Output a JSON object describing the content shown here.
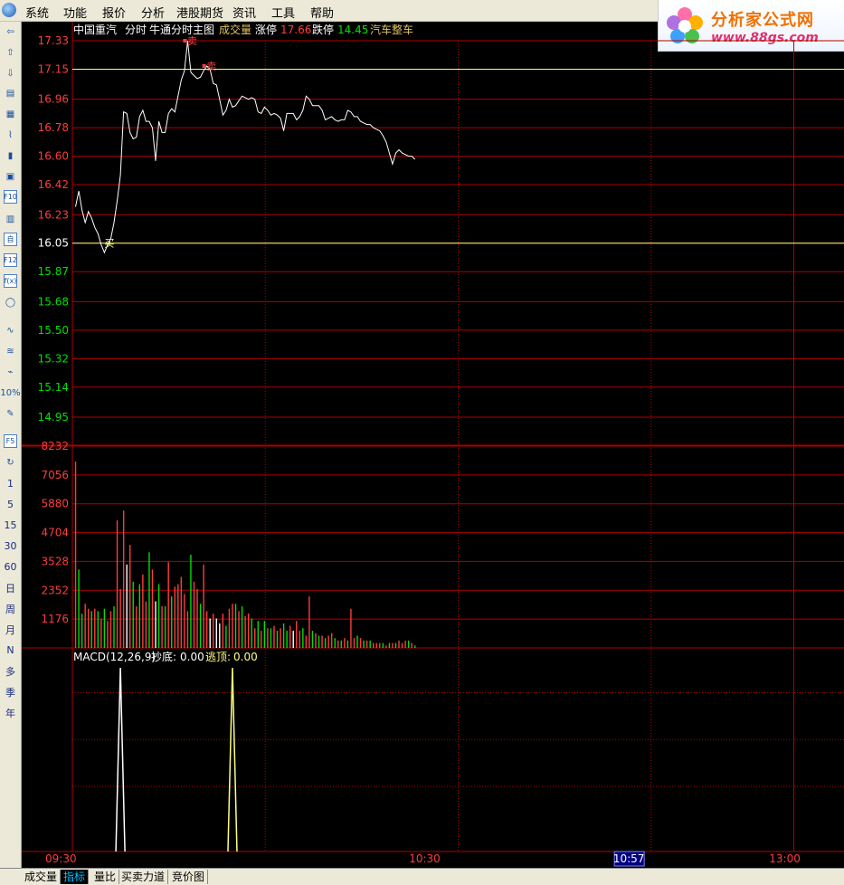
{
  "menu": [
    "系统",
    "功能",
    "报价",
    "分析",
    "港股期货",
    "资讯",
    "工具",
    "帮助"
  ],
  "brand": {
    "name": "分析家公式网",
    "url": "www.88gs.com"
  },
  "toolbar": {
    "icons": [
      "back-arrow-icon",
      "up-arrow-icon",
      "down-arrow-icon",
      "quote-list-icon",
      "grid-icon",
      "line-chart-icon",
      "candlestick-icon",
      "window-icon",
      "f10-icon",
      "file-icon",
      "self-select-icon",
      "f12-icon",
      "formula-icon",
      "circle-icon",
      "wave-icon",
      "area-wave-icon",
      "pulse-icon",
      "percent-icon",
      "pencil-icon",
      "f5-icon",
      "refresh-icon"
    ],
    "labels": {
      "f10": "F10",
      "self": "自",
      "f12": "F12",
      "fx": "f(x)",
      "pct": "10%",
      "f5": "F5"
    },
    "periods": [
      "1",
      "5",
      "15",
      "30",
      "60",
      "日",
      "周",
      "月",
      "N",
      "多",
      "季",
      "年"
    ]
  },
  "header": {
    "stock": "中国重汽",
    "view": "分时",
    "indicator": "牛通分时主图",
    "volume_label": "成交量",
    "limit_up_label": "涨停",
    "limit_up": "17.66",
    "limit_down_label": "跌停",
    "limit_down": "14.45",
    "sector": "汽车整车"
  },
  "signals": {
    "buy": "买",
    "sell": "卖"
  },
  "macd_header": {
    "name": "MACD(12,26,9)",
    "bottom_label": "抄底:",
    "bottom_value": "0.00",
    "top_label": "逃顶:",
    "top_value": "0.00"
  },
  "time_axis": {
    "labels": [
      "09:30",
      "10:30",
      "13:00"
    ],
    "cursor": "10:57"
  },
  "bottom_tabs": [
    {
      "label": "成交量",
      "active": false
    },
    {
      "label": "指标",
      "active": true
    },
    {
      "label": "量比",
      "active": false
    },
    {
      "label": "买卖力道",
      "active": false
    },
    {
      "label": "竞价图",
      "active": false
    }
  ],
  "colors": {
    "up": "#ff3c3c",
    "down": "#00e000",
    "flat": "#ffffff",
    "grid": "#b00000",
    "price_line": "#ffffff",
    "ref_line": "#ffff80",
    "macd_top": "#ffff80"
  },
  "chart_data": {
    "type": "line",
    "price_ylim": [
      14.95,
      17.33
    ],
    "price_ticks": [
      "17.33",
      "17.15",
      "16.96",
      "16.78",
      "16.60",
      "16.42",
      "16.23",
      "16.05",
      "15.87",
      "15.68",
      "15.50",
      "15.32",
      "15.14",
      "14.95"
    ],
    "prev_close": 16.05,
    "ref_line": 17.15,
    "volume_ylim": [
      0,
      8232
    ],
    "volume_ticks": [
      "8232",
      "7056",
      "5880",
      "4704",
      "3528",
      "2352",
      "1176"
    ],
    "price": [
      16.28,
      16.38,
      16.26,
      16.18,
      16.25,
      16.21,
      16.15,
      16.11,
      16.04,
      15.99,
      16.04,
      16.08,
      16.18,
      16.32,
      16.48,
      16.88,
      16.87,
      16.75,
      16.71,
      16.72,
      16.85,
      16.89,
      16.82,
      16.82,
      16.78,
      16.57,
      16.82,
      16.75,
      16.75,
      16.87,
      16.9,
      16.88,
      16.98,
      17.08,
      17.14,
      17.33,
      17.13,
      17.11,
      17.09,
      17.1,
      17.14,
      17.17,
      17.15,
      17.06,
      17.05,
      16.96,
      16.86,
      16.89,
      16.96,
      16.91,
      16.92,
      16.95,
      16.98,
      16.97,
      16.96,
      16.97,
      16.96,
      16.88,
      16.87,
      16.91,
      16.89,
      16.86,
      16.87,
      16.86,
      16.84,
      16.76,
      16.87,
      16.87,
      16.87,
      16.83,
      16.85,
      16.89,
      16.98,
      16.96,
      16.92,
      16.92,
      16.92,
      16.89,
      16.83,
      16.84,
      16.85,
      16.83,
      16.82,
      16.83,
      16.83,
      16.89,
      16.88,
      16.85,
      16.85,
      16.82,
      16.81,
      16.8,
      16.8,
      16.78,
      16.77,
      16.76,
      16.73,
      16.69,
      16.62,
      16.55,
      16.62,
      16.64,
      16.62,
      16.61,
      16.6,
      16.6,
      16.58
    ],
    "volume": [
      7600,
      3200,
      1400,
      1800,
      1600,
      1500,
      1600,
      1500,
      1200,
      1600,
      1100,
      1500,
      1700,
      5200,
      2400,
      5600,
      3400,
      4200,
      2700,
      1700,
      2600,
      3000,
      1900,
      3900,
      3200,
      1900,
      2600,
      1700,
      1700,
      3500,
      2100,
      2500,
      2600,
      2900,
      2200,
      1500,
      3800,
      2700,
      2400,
      1800,
      3400,
      1500,
      1200,
      1400,
      1200,
      1000,
      1400,
      900,
      1600,
      1800,
      1800,
      1500,
      1700,
      1300,
      1400,
      1200,
      800,
      1100,
      700,
      1100,
      800,
      800,
      900,
      700,
      800,
      1000,
      700,
      900,
      700,
      1100,
      700,
      800,
      500,
      2100,
      700,
      600,
      500,
      500,
      400,
      500,
      600,
      400,
      300,
      300,
      400,
      300,
      1600,
      400,
      500,
      400,
      300,
      300,
      300,
      200,
      200,
      200,
      200,
      100,
      200,
      200,
      200,
      300,
      200,
      300,
      300,
      200,
      100
    ],
    "volume_dir": [
      "up",
      "down",
      "down",
      "up",
      "up",
      "down",
      "up",
      "down",
      "up",
      "down",
      "up",
      "up",
      "down",
      "up",
      "up",
      "up",
      "flat",
      "up",
      "down",
      "up",
      "down",
      "up",
      "up",
      "down",
      "up",
      "flat",
      "down",
      "up",
      "down",
      "up",
      "down",
      "up",
      "up",
      "up",
      "up",
      "up",
      "down",
      "up",
      "up",
      "down",
      "up",
      "up",
      "flat",
      "up",
      "flat",
      "flat",
      "up",
      "down",
      "up",
      "up",
      "down",
      "up",
      "down",
      "up",
      "up",
      "down",
      "up",
      "down",
      "up",
      "down",
      "up",
      "down",
      "up",
      "down",
      "up",
      "down",
      "down",
      "up",
      "flat",
      "up",
      "up",
      "down",
      "up",
      "up",
      "down",
      "up",
      "down",
      "up",
      "down",
      "up",
      "up",
      "down",
      "up",
      "down",
      "up",
      "down",
      "up",
      "up",
      "down",
      "up",
      "down",
      "up",
      "down",
      "up",
      "up",
      "up",
      "down",
      "up",
      "down",
      "up",
      "down",
      "up",
      "up",
      "up",
      "down",
      "up",
      "down"
    ],
    "buy_index": 10,
    "sell_indices": [
      35,
      41
    ],
    "macd_spikes": [
      {
        "index": 14,
        "series": "抄底"
      },
      {
        "index": 49,
        "series": "逃顶"
      }
    ]
  }
}
